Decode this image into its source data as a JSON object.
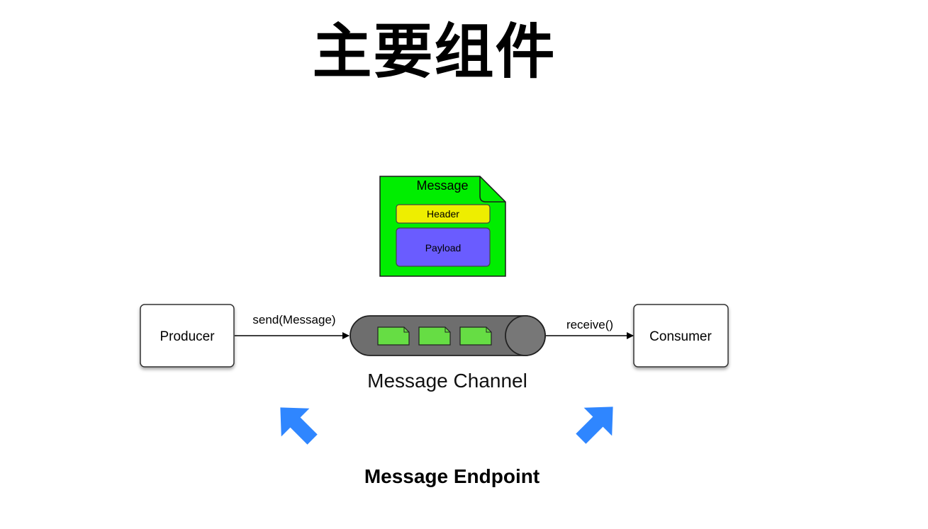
{
  "title": "主要组件",
  "message": {
    "label": "Message",
    "header_label": "Header",
    "payload_label": "Payload"
  },
  "producer": {
    "label": "Producer",
    "send_label": "send(Message)"
  },
  "channel": {
    "label": "Message Channel"
  },
  "consumer": {
    "label": "Consumer",
    "receive_label": "receive()"
  },
  "endpoint": {
    "label": "Message Endpoint"
  },
  "colors": {
    "message_doc": "#00ee00",
    "header": "#eeee00",
    "payload": "#6a5cff",
    "channel": "#6e6e6e",
    "channel_item": "#66dd44",
    "endpoint_arrow": "#2f86ff"
  }
}
